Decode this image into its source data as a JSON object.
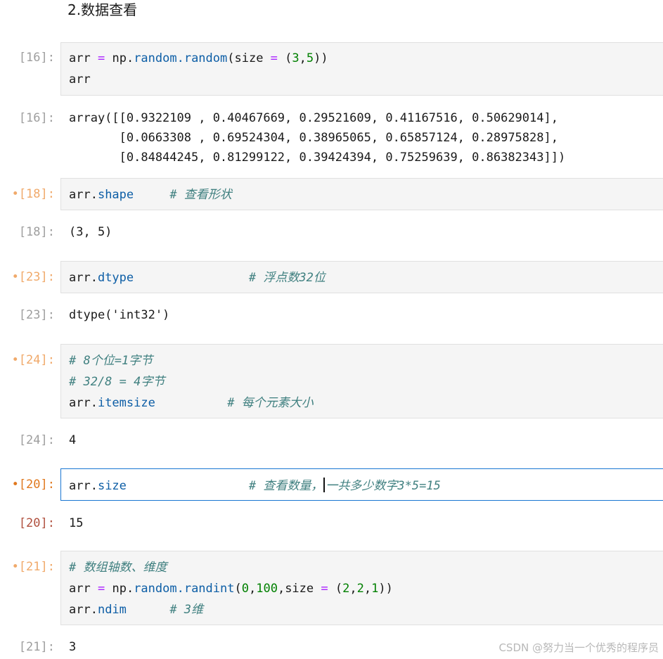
{
  "heading": "2.数据查看",
  "cells": {
    "c16": {
      "in_prompt": "[16]:",
      "out_prompt": "[16]:",
      "line1": {
        "v1": "arr",
        "eq": "=",
        "np": "np.",
        "fn": "random.random",
        "a1": "(size ",
        "eq2": "=",
        "a2": " (",
        "n1": "3",
        "c": ",",
        "n2": "5",
        "a3": "))"
      },
      "line2": "arr",
      "out_lines": [
        "array([[0.9322109 , 0.40467669, 0.29521609, 0.41167516, 0.50629014],",
        "       [0.0663308 , 0.69524304, 0.38965065, 0.65857124, 0.28975828],",
        "       [0.84844245, 0.81299122, 0.39424394, 0.75259639, 0.86382343]])"
      ]
    },
    "c18": {
      "marker": "•",
      "in_prompt": "[18]:",
      "out_prompt": "[18]:",
      "code_obj": "arr.",
      "code_attr": "shape",
      "comment": "# 查看形状",
      "output": "(3, 5)"
    },
    "c23": {
      "marker": "•",
      "in_prompt": "[23]:",
      "out_prompt": "[23]:",
      "code_obj": "arr.",
      "code_attr": "dtype",
      "comment": "# 浮点数32位",
      "output": "dtype('int32')"
    },
    "c24": {
      "marker": "•",
      "in_prompt": "[24]:",
      "out_prompt": "[24]:",
      "comment1": "# 8个位=1字节",
      "comment2": "# 32/8 = 4字节",
      "code_obj": "arr.",
      "code_attr": "itemsize",
      "comment3": "# 每个元素大小",
      "output": "4"
    },
    "c20": {
      "marker": "•",
      "in_prompt": "[20]:",
      "out_prompt": "[20]:",
      "code_obj": "arr.",
      "code_attr": "size",
      "comment_a": "# 查看数量，",
      "comment_b": "一共多少数字3*5=15",
      "output": "15"
    },
    "c21": {
      "marker": "•",
      "in_prompt": "[21]:",
      "out_prompt": "[21]:",
      "comment1": "# 数组轴数、维度",
      "line2": {
        "v1": "arr",
        "eq": "=",
        "np": "np.",
        "fn": "random.randint",
        "a1": "(",
        "n1": "0",
        "c1": ",",
        "n2": "100",
        "a2": ",size ",
        "eq2": "=",
        "a3": " (",
        "n3": "2",
        "c2": ",",
        "n4": "2",
        "c3": ",",
        "n5": "1",
        "a4": "))"
      },
      "code_obj": "arr.",
      "code_attr": "ndim",
      "comment3": "# 3维",
      "output": "3"
    }
  },
  "watermark": "CSDN @努力当一个优秀的程序员",
  "colors": {
    "prompt": "#9e9e9e",
    "modified_prompt": "#f0a96a",
    "active_prompt": "#e0781e",
    "selected_border": "#1976d2",
    "function": "#0d5ea6",
    "operator": "#aa22ff",
    "number": "#008000",
    "comment": "#408080"
  }
}
